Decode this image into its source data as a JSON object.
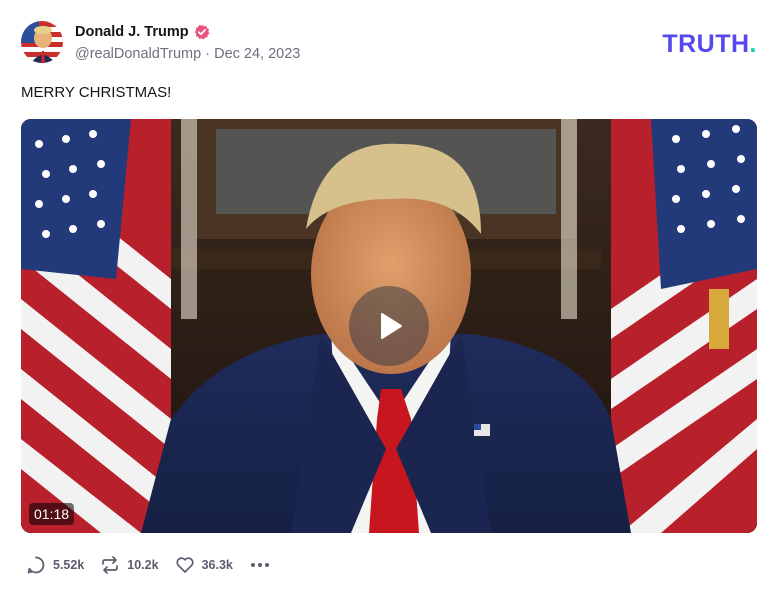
{
  "author": {
    "display_name": "Donald J. Trump",
    "handle": "@realDonaldTrump",
    "separator": " · ",
    "date": "Dec 24, 2023",
    "verified_icon": "verified-badge-icon"
  },
  "brand": {
    "name": "TRUTH",
    "dot": "."
  },
  "post": {
    "text": "MERRY CHRISTMAS!"
  },
  "video": {
    "duration": "01:18",
    "play_icon": "play-icon"
  },
  "actions": {
    "replies": "5.52k",
    "retruths": "10.2k",
    "likes": "36.3k"
  },
  "colors": {
    "brand_purple": "#5448ee",
    "brand_teal": "#0bd3b1",
    "verified_pink": "#e8537a",
    "muted_text": "#6f6f80"
  }
}
